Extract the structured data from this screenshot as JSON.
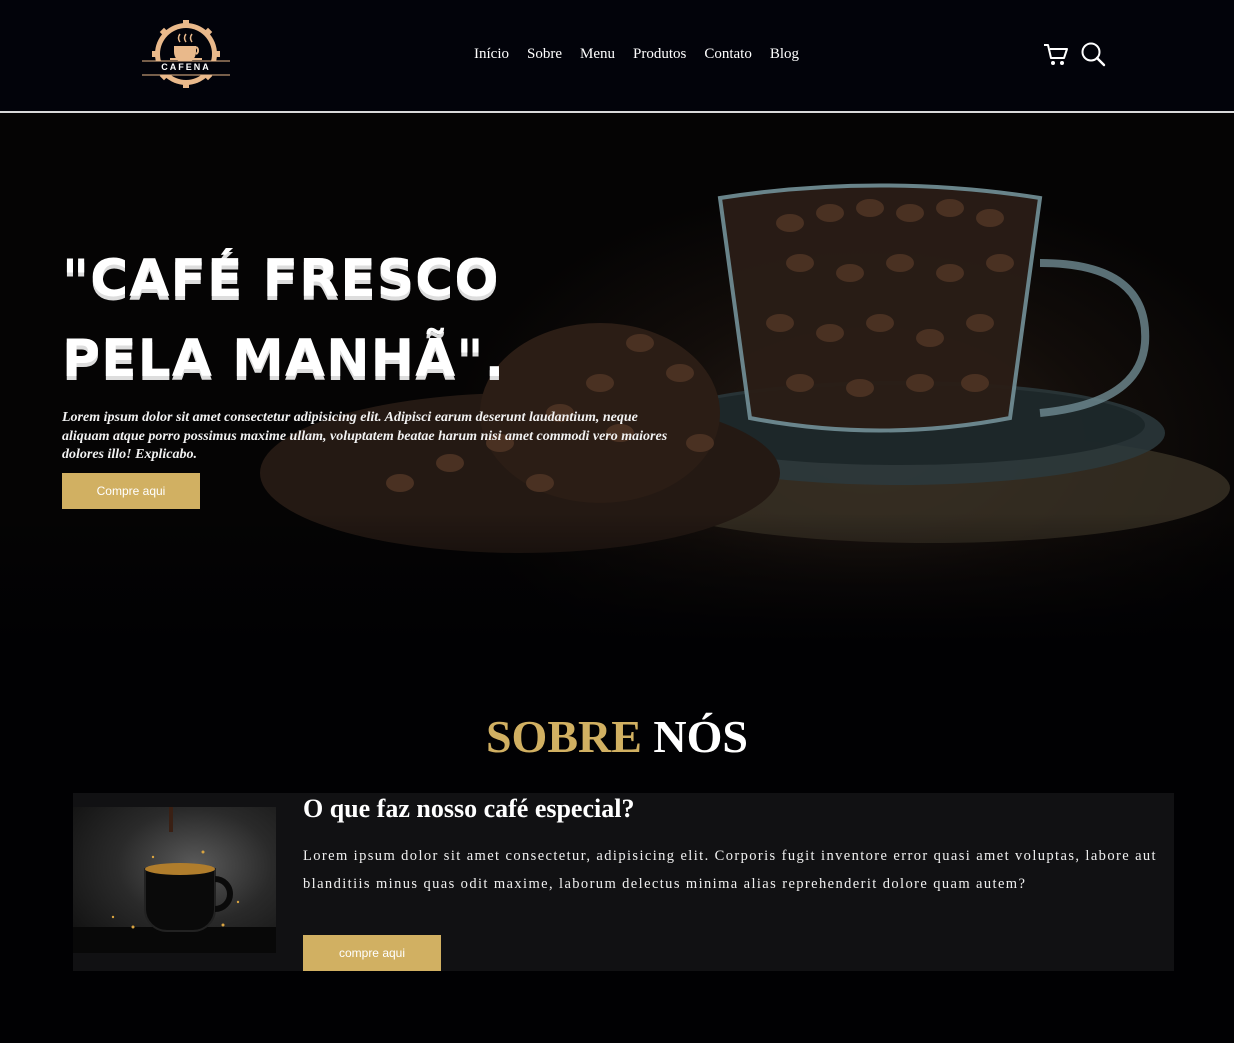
{
  "header": {
    "logo_text": "CAFENA",
    "nav": [
      "Início",
      "Sobre",
      "Menu",
      "Produtos",
      "Contato",
      "Blog"
    ],
    "icons": [
      "cart-icon",
      "search-icon"
    ]
  },
  "hero": {
    "title_line1": "\"CAFÉ FRESCO",
    "title_line2": "PELA MANHÃ\".",
    "text": "Lorem ipsum dolor sit amet consectetur adipisicing elit. Adipisci earum deserunt laudantium, neque aliquam atque porro possimus maxime ullam, voluptatem beatae harum nisi amet commodi vero maiores dolores illo! Explicabo.",
    "button": "Compre aqui"
  },
  "about": {
    "title_gold": "SOBRE",
    "title_white": "NÓS",
    "card_title": "O que faz nosso café especial?",
    "card_text": "Lorem ipsum dolor sit amet consectetur, adipisicing elit. Corporis fugit inventore error quasi amet voluptas, labore aut blanditiis minus quas odit maxime, laborum delectus minima alias reprehenderit dolore quam autem?",
    "button": "compre aqui"
  },
  "colors": {
    "accent": "#d1b062",
    "background": "#010103",
    "card": "#111113"
  }
}
